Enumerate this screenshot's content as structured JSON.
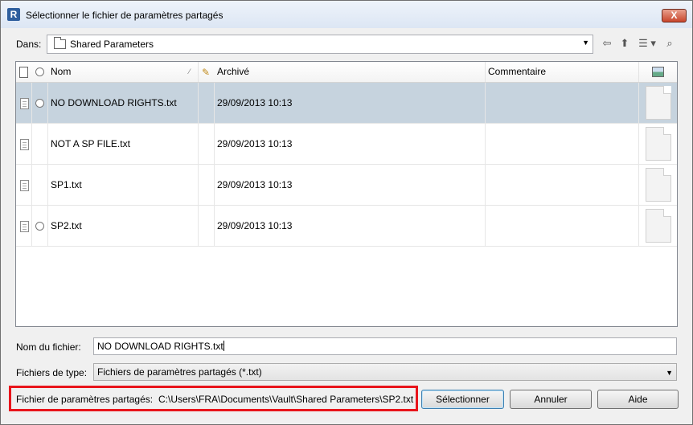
{
  "window": {
    "title": "Sélectionner le fichier de paramètres partagés",
    "close_label": "X",
    "app_letter": "R"
  },
  "location": {
    "label": "Dans:",
    "folder": "Shared Parameters"
  },
  "toolbar": {
    "back_icon": "⇦",
    "up_icon": "⬆",
    "views_icon": "☰ ▾",
    "binoculars_icon": "⌕"
  },
  "columns": {
    "name": "Nom",
    "archived": "Archivé",
    "comment": "Commentaire"
  },
  "files": [
    {
      "name": "NO DOWNLOAD RIGHTS.txt",
      "date": "29/09/2013 10:13",
      "comment": "",
      "has_radio": true,
      "selected": true
    },
    {
      "name": "NOT A SP FILE.txt",
      "date": "29/09/2013 10:13",
      "comment": "",
      "has_radio": false,
      "selected": false
    },
    {
      "name": "SP1.txt",
      "date": "29/09/2013 10:13",
      "comment": "",
      "has_radio": false,
      "selected": false
    },
    {
      "name": "SP2.txt",
      "date": "29/09/2013 10:13",
      "comment": "",
      "has_radio": true,
      "selected": false
    }
  ],
  "filename": {
    "label": "Nom du fichier:",
    "value": "NO DOWNLOAD RIGHTS.txt"
  },
  "filetype": {
    "label": "Fichiers de type:",
    "value": "Fichiers de paramètres partagés (*.txt)"
  },
  "shared": {
    "label": "Fichier de paramètres partagés:",
    "path": "C:\\Users\\FRA\\Documents\\Vault\\Shared Parameters\\SP2.txt"
  },
  "buttons": {
    "select": "Sélectionner",
    "cancel": "Annuler",
    "help": "Aide"
  },
  "colors": {
    "selected_row": "#c6d3de",
    "highlight_border": "#e8141b"
  }
}
